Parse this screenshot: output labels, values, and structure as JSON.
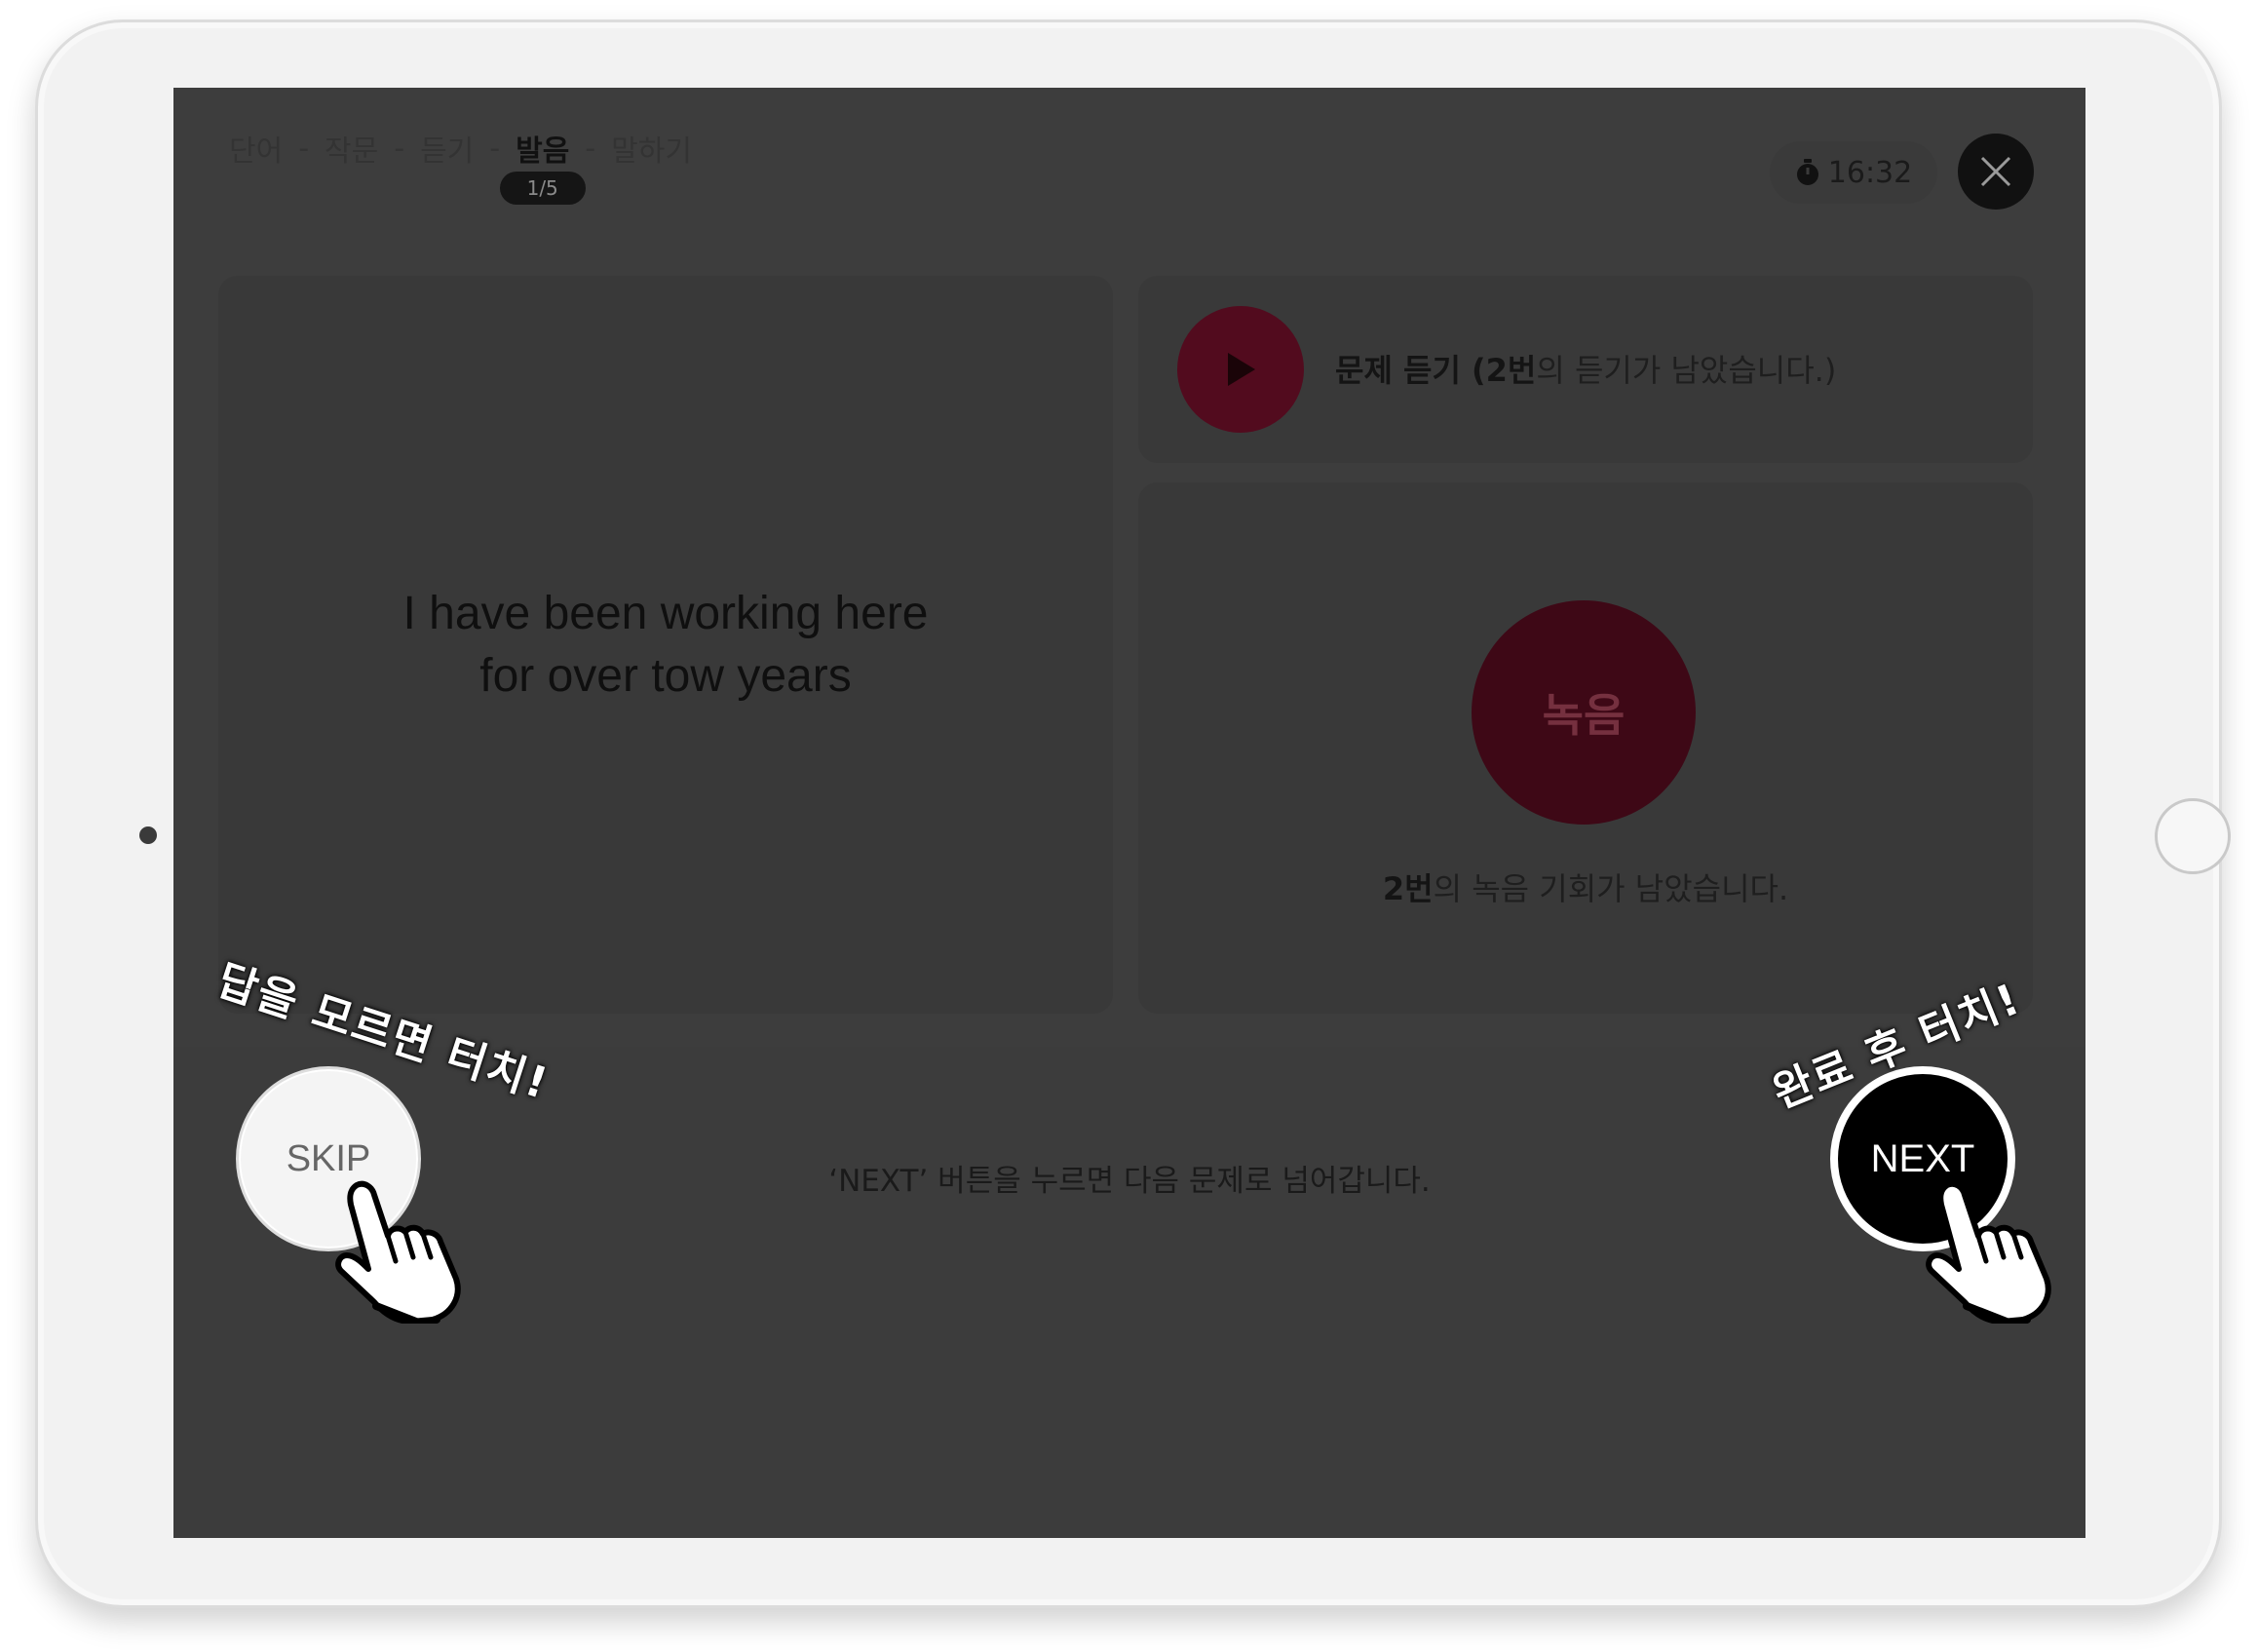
{
  "steps": [
    {
      "label": "단어",
      "active": false
    },
    {
      "label": "작문",
      "active": false
    },
    {
      "label": "듣기",
      "active": false
    },
    {
      "label": "발음",
      "active": true
    },
    {
      "label": "말하기",
      "active": false
    }
  ],
  "step_separator": "-",
  "step_counter": "1/5",
  "timer": "16:32",
  "sentence": {
    "line1": "I have been working here",
    "line2": "for over tow years"
  },
  "listen": {
    "label_bold": "문제 듣기 (2번",
    "label_rest": "의 듣기가 남았습니다.)"
  },
  "record": {
    "button_label": "녹음",
    "remaining_bold": "2번",
    "remaining_rest": "의 녹음 기회가 남았습니다."
  },
  "bottom_hint": "‘NEXT’ 버튼을 누르면 다음 문제로 넘어갑니다.",
  "skip_label": "SKIP",
  "next_label": "NEXT",
  "callouts": {
    "skip": "답을 모르면 터치!",
    "next": "완료 후 터치!"
  },
  "colors": {
    "screen_bg": "#3d3d3d",
    "panel_bg": "#393939",
    "play_button": "#520b1e",
    "record_button": "#3e0816",
    "close_button": "#111111"
  }
}
